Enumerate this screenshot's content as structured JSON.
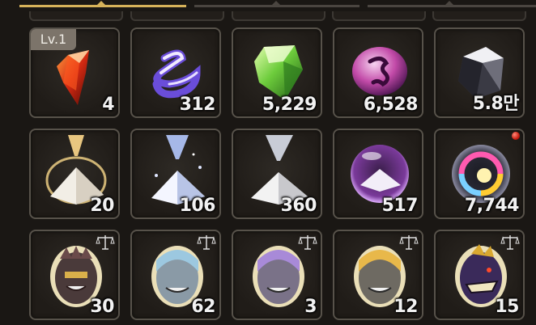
{
  "tabs": [
    {
      "name": "tab-1",
      "active": true
    },
    {
      "name": "tab-2",
      "active": false
    },
    {
      "name": "tab-3",
      "active": false
    }
  ],
  "colors": {
    "accent": "#d6b25a",
    "slot_border": "#57524a",
    "count_text": "#f2f2f2"
  },
  "level_badge": "Lv.1",
  "rows": [
    [
      {
        "item": "red-crystal-shard",
        "icon": "red-shard-icon",
        "count": "4",
        "badge": "Lv.1"
      },
      {
        "item": "purple-swirl-essence",
        "icon": "purple-swirl-icon",
        "count": "312"
      },
      {
        "item": "green-crystal",
        "icon": "green-crystal-icon",
        "count": "5,229"
      },
      {
        "item": "pink-rune-stone",
        "icon": "rune-stone-icon",
        "count": "6,528"
      },
      {
        "item": "dark-ore",
        "icon": "dark-ore-icon",
        "count": "5.8만"
      }
    ],
    [
      {
        "item": "golden-sand-powder",
        "icon": "sand-pile-icon",
        "count": "20"
      },
      {
        "item": "blue-sand-powder",
        "icon": "sand-pile-icon",
        "count": "106"
      },
      {
        "item": "white-sand-powder",
        "icon": "sand-pile-icon",
        "count": "360"
      },
      {
        "item": "powder-orb",
        "icon": "orb-icon",
        "count": "517"
      },
      {
        "item": "rainbow-orb",
        "icon": "rainbow-orb-icon",
        "count": "7,744",
        "new": true
      }
    ],
    [
      {
        "item": "dark-mask-egg",
        "icon": "mask-egg-icon",
        "count": "30",
        "tradable": true
      },
      {
        "item": "blue-hair-mask-egg",
        "icon": "mask-egg-icon",
        "count": "62",
        "tradable": true
      },
      {
        "item": "purple-hair-mask-egg",
        "icon": "mask-egg-icon",
        "count": "3",
        "tradable": true
      },
      {
        "item": "blonde-mask-egg",
        "icon": "mask-egg-icon",
        "count": "12",
        "tradable": true
      },
      {
        "item": "beast-mask-egg",
        "icon": "mask-egg-icon",
        "count": "15",
        "tradable": true
      }
    ]
  ]
}
